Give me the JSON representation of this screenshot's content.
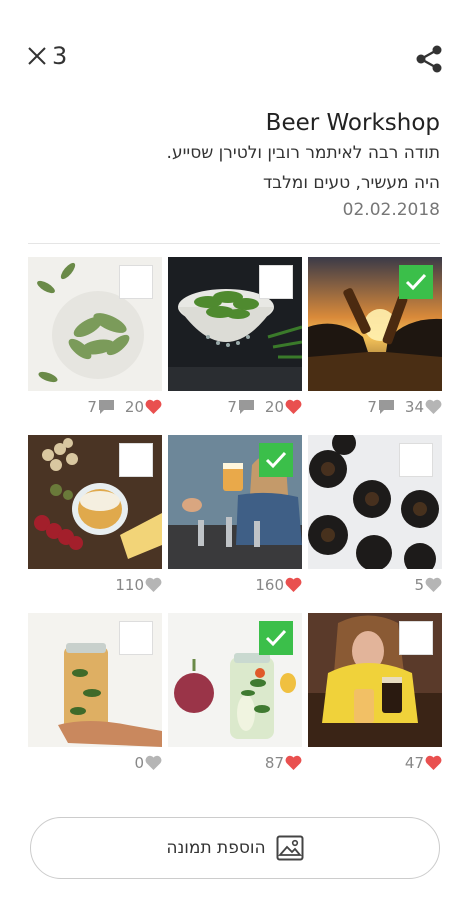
{
  "header": {
    "selected_count": "3",
    "title": "Beer Workshop",
    "description": "תודה רבה לאיתמר רובין ולטירן שסייע.\nהיה מעשיר, טעים ומלבד",
    "date": "02.02.2018"
  },
  "photos": [
    {
      "subject": "bay-leaves",
      "selected": false,
      "likes": "20",
      "liked": true,
      "comments": "7"
    },
    {
      "subject": "cucumbers-colander",
      "selected": false,
      "likes": "20",
      "liked": true,
      "comments": "7"
    },
    {
      "subject": "beer-toast-sunset",
      "selected": true,
      "likes": "34",
      "liked": false,
      "comments": "7"
    },
    {
      "subject": "snack-board",
      "selected": false,
      "likes": "110",
      "liked": false,
      "comments": ""
    },
    {
      "subject": "bartender-tap",
      "selected": true,
      "likes": "160",
      "liked": true,
      "comments": ""
    },
    {
      "subject": "beer-bottles",
      "selected": false,
      "likes": "5",
      "liked": false,
      "comments": ""
    },
    {
      "subject": "pickle-jar-hand",
      "selected": false,
      "likes": "0",
      "liked": false,
      "comments": ""
    },
    {
      "subject": "pickle-jar-onion",
      "selected": true,
      "likes": "87",
      "liked": true,
      "comments": ""
    },
    {
      "subject": "girl-with-beer",
      "selected": false,
      "likes": "47",
      "liked": true,
      "comments": ""
    }
  ],
  "add_photo_label": "הוספת תמונה",
  "colors": {
    "check_green": "#3bbf4a",
    "heart_red": "#e9504f",
    "muted_gray": "#999999"
  }
}
